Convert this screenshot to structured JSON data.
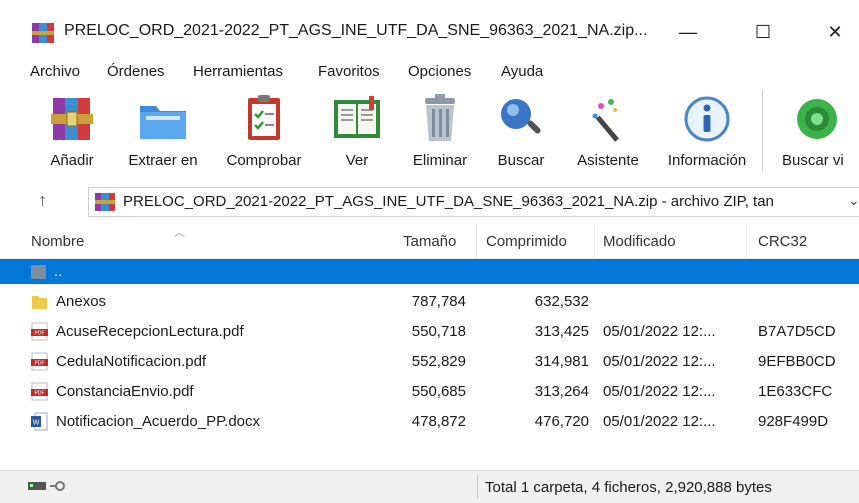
{
  "window": {
    "title": "PRELOC_ORD_2021-2022_PT_AGS_INE_UTF_DA_SNE_96363_2021_NA.zip...",
    "minimize": "—",
    "maximize": "☐",
    "close": "✕"
  },
  "menu": [
    "Archivo",
    "Órdenes",
    "Herramientas",
    "Favoritos",
    "Opciones",
    "Ayuda"
  ],
  "toolbar": [
    {
      "label": "Añadir",
      "icon": "add-archive-icon"
    },
    {
      "label": "Extraer en",
      "icon": "extract-folder-icon"
    },
    {
      "label": "Comprobar",
      "icon": "test-clipboard-icon"
    },
    {
      "label": "Ver",
      "icon": "view-book-icon"
    },
    {
      "label": "Eliminar",
      "icon": "trash-icon"
    },
    {
      "label": "Buscar",
      "icon": "search-magnifier-icon"
    },
    {
      "label": "Asistente",
      "icon": "wizard-wand-icon"
    },
    {
      "label": "Información",
      "icon": "info-icon"
    },
    {
      "label": "Buscar vi",
      "icon": "virus-scan-icon"
    }
  ],
  "address": {
    "up": "↑",
    "path": "PRELOC_ORD_2021-2022_PT_AGS_INE_UTF_DA_SNE_96363_2021_NA.zip - archivo ZIP, tan"
  },
  "columns": {
    "name": "Nombre",
    "size": "Tamaño",
    "packed": "Comprimido",
    "modified": "Modificado",
    "crc": "CRC32"
  },
  "files": [
    {
      "name": "..",
      "type": "parent",
      "size": "",
      "packed": "",
      "modified": "",
      "crc": ""
    },
    {
      "name": "Anexos",
      "type": "folder",
      "size": "787,784",
      "packed": "632,532",
      "modified": "",
      "crc": ""
    },
    {
      "name": "AcuseRecepcionLectura.pdf",
      "type": "pdf",
      "size": "550,718",
      "packed": "313,425",
      "modified": "05/01/2022 12:...",
      "crc": "B7A7D5CD"
    },
    {
      "name": "CedulaNotificacion.pdf",
      "type": "pdf",
      "size": "552,829",
      "packed": "314,981",
      "modified": "05/01/2022 12:...",
      "crc": "9EFBB0CD"
    },
    {
      "name": "ConstanciaEnvio.pdf",
      "type": "pdf",
      "size": "550,685",
      "packed": "313,264",
      "modified": "05/01/2022 12:...",
      "crc": "1E633CFC"
    },
    {
      "name": "Notificacion_Acuerdo_PP.docx",
      "type": "docx",
      "size": "478,872",
      "packed": "476,720",
      "modified": "05/01/2022 12:...",
      "crc": "928F499D"
    }
  ],
  "status": {
    "summary": "Total 1 carpeta, 4 ficheros, 2,920,888 bytes"
  },
  "colors": {
    "selection": "#0078d7",
    "pdf": "#c62828",
    "folder": "#f2c84b",
    "word": "#2b5797"
  }
}
